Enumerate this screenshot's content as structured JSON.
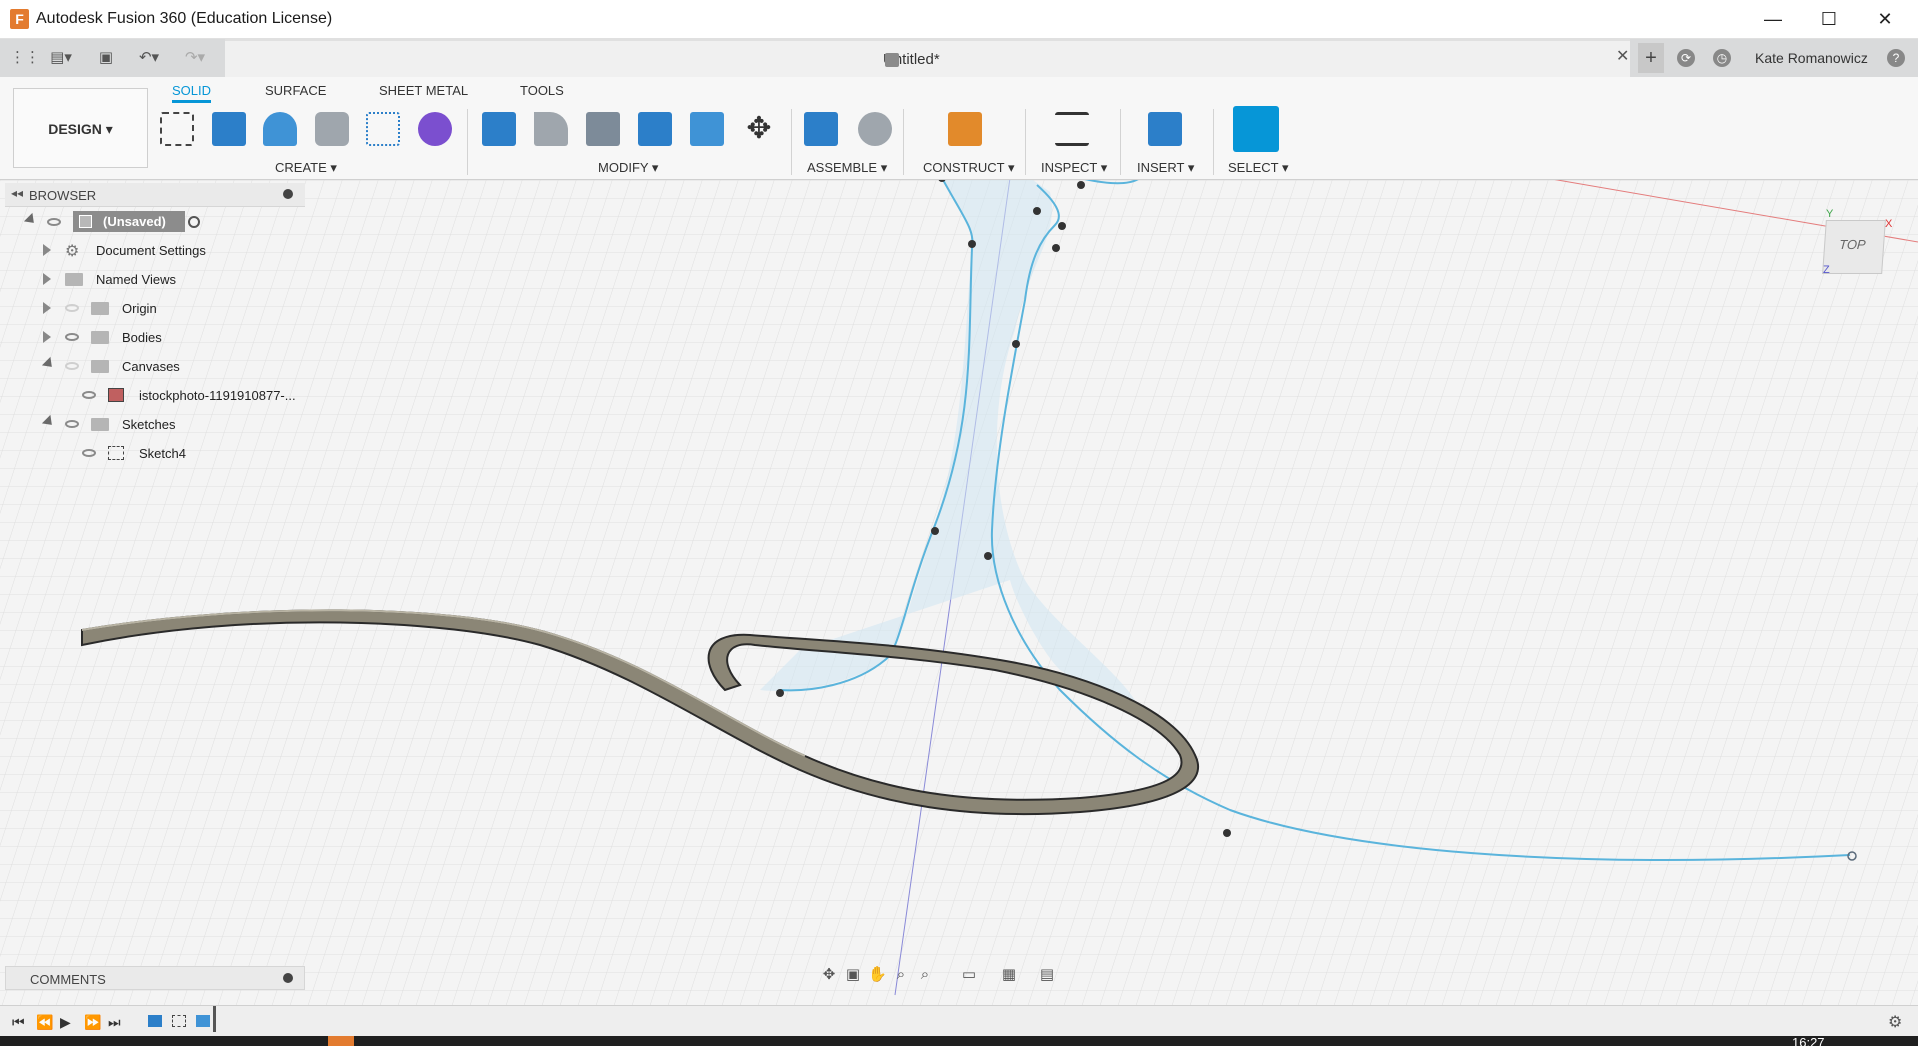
{
  "window": {
    "title": "Autodesk Fusion 360 (Education License)",
    "logo_letter": "F"
  },
  "document": {
    "tab_title": "Untitled*",
    "user_name": "Kate Romanowicz"
  },
  "toolbar": {
    "workspace": "DESIGN ▾",
    "tabs": [
      "SOLID",
      "SURFACE",
      "SHEET METAL",
      "TOOLS"
    ],
    "active_tab": "SOLID",
    "groups": [
      "CREATE ▾",
      "MODIFY ▾",
      "ASSEMBLE ▾",
      "CONSTRUCT ▾",
      "INSPECT ▾",
      "INSERT ▾",
      "SELECT ▾"
    ]
  },
  "browser": {
    "title": "BROWSER",
    "items": [
      {
        "label": "(Unsaved)"
      },
      {
        "label": "Document Settings"
      },
      {
        "label": "Named Views"
      },
      {
        "label": "Origin"
      },
      {
        "label": "Bodies"
      },
      {
        "label": "Canvases"
      },
      {
        "label": "istockphoto-1191910877-..."
      },
      {
        "label": "Sketches"
      },
      {
        "label": "Sketch4"
      }
    ]
  },
  "comments": {
    "title": "COMMENTS"
  },
  "viewcube": {
    "label": "TOP",
    "axis_y": "Y",
    "axis_x": "X",
    "axis_z": "Z"
  },
  "taskbar": {
    "clock": "16:27"
  },
  "colors": {
    "accent": "#0696d7",
    "sketch_line": "#5ab4dc",
    "body_fill": "#8b8676",
    "select_btn": "#0696d7"
  }
}
